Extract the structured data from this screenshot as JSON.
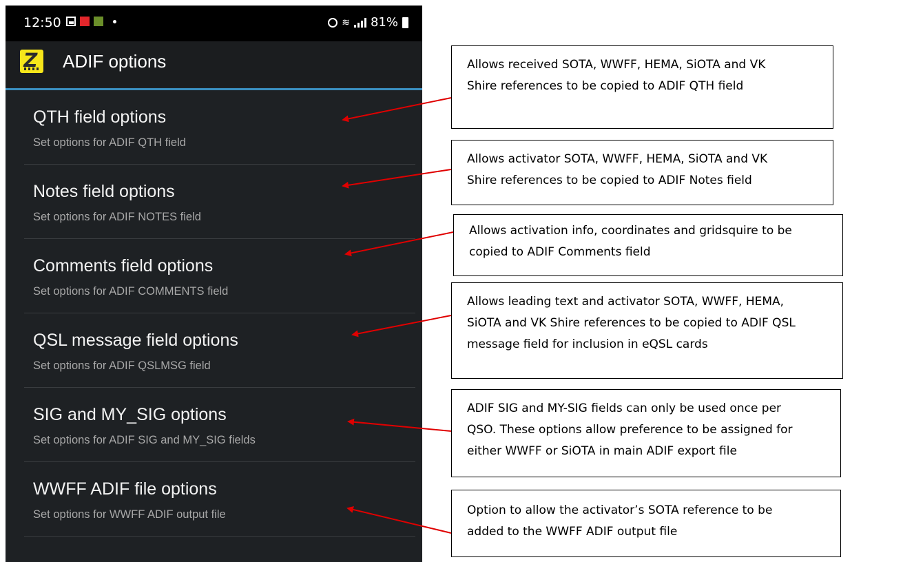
{
  "status_bar": {
    "time": "12:50",
    "battery": "81%",
    "icons": [
      "gallery-icon",
      "red-app-icon",
      "green-app-icon",
      "dot-icon",
      "alarm-icon",
      "wifi-calling-icon",
      "signal-icon",
      "battery-icon"
    ]
  },
  "app_bar": {
    "title": "ADIF options",
    "logo_icon": "ham-app-logo-icon",
    "logo_color": "#f7e61a"
  },
  "accent_color": "#3a8fc0",
  "menu": {
    "items": [
      {
        "title": "QTH field options",
        "subtitle": "Set options for ADIF QTH field"
      },
      {
        "title": "Notes field options",
        "subtitle": "Set options for ADIF NOTES field"
      },
      {
        "title": "Comments field options",
        "subtitle": "Set options for ADIF COMMENTS field"
      },
      {
        "title": "QSL message field options",
        "subtitle": "Set options for ADIF QSLMSG field"
      },
      {
        "title": "SIG and MY_SIG options",
        "subtitle": "Set options for ADIF SIG and MY_SIG fields"
      },
      {
        "title": "WWFF ADIF file options",
        "subtitle": "Set options for WWFF ADIF output file"
      }
    ]
  },
  "callouts": [
    {
      "text": "Allows received SOTA, WWFF, HEMA, SiOTA and VK\nShire references to be copied to ADIF QTH field"
    },
    {
      "text": "Allows activator SOTA, WWFF, HEMA, SiOTA and VK\nShire references to be copied to ADIF Notes field"
    },
    {
      "text": "Allows activation info, coordinates and gridsquire to be\ncopied to ADIF Comments field"
    },
    {
      "text": "Allows leading text and activator SOTA, WWFF, HEMA,\nSiOTA and VK Shire references to be copied to ADIF QSL\nmessage field for inclusion in eQSL cards"
    },
    {
      "text": "ADIF SIG and MY-SIG fields can only be used once per\nQSO. These options allow preference to be assigned for\neither WWFF or SiOTA in main ADIF export file"
    },
    {
      "text": "Option to allow the activator’s SOTA reference to be\nadded to the WWFF ADIF output file"
    }
  ],
  "arrow_color": "#e00000"
}
